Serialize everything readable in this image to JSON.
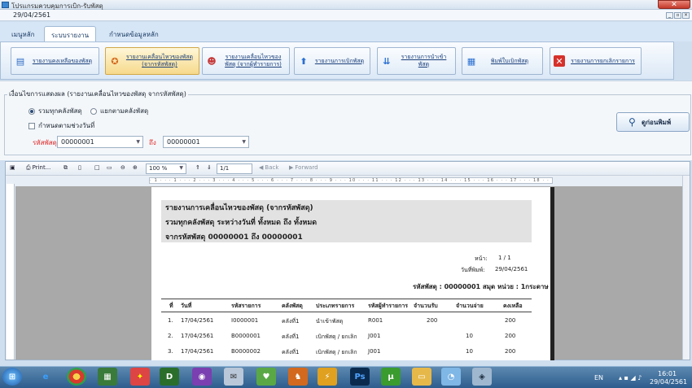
{
  "window": {
    "title": "โปรแกรมควบคุมการเบิก-รับพัสดุ",
    "date": "29/04/2561"
  },
  "tabs": [
    "เมนูหลัก",
    "ระบบรายงาน",
    "กำหนดข้อมูลหลัก"
  ],
  "ribbon": [
    {
      "label": "รายงานคงเหลือของพัสดุ",
      "icon": "stock-report-icon"
    },
    {
      "label": "รายงานเคลื่อนไหวของพัสดุ (จากรหัสพัสดุ)",
      "icon": "movement-by-item-icon"
    },
    {
      "label": "รายงานเคลื่อนไหวของพัสดุ (จากผู้ทำรายการ)",
      "icon": "movement-by-user-icon"
    },
    {
      "label": "รายงานการเบิกพัสดุ",
      "icon": "withdraw-report-icon"
    },
    {
      "label": "รายงานการนำเข้าพัสดุ",
      "icon": "import-report-icon"
    },
    {
      "label": "พิมพ์ใบเบิกพัสดุ",
      "icon": "print-form-icon"
    },
    {
      "label": "รายงานการยกเลิกรายการ",
      "icon": "cancel-report-icon"
    }
  ],
  "options": {
    "group_title": "เงื่อนไขการแสดงผล (รายงานเคลื่อนไหวของพัสดุ จากรหัสพัสดุ)",
    "radio_all": "รวมทุกคลังพัสดุ",
    "radio_split": "แยกตามคลังพัสดุ",
    "date_check": "กำหนดตามช่วงวันที่",
    "code_label": "รหัสพัสดุ",
    "code_from": "00000001",
    "to_label": "ถึง",
    "code_to": "00000001",
    "preview_button": "ดูก่อนพิมพ์"
  },
  "viewer": {
    "print_label": "Print...",
    "zoom": "100 %",
    "page_box": "1/1",
    "back": "Back",
    "forward": "Forward"
  },
  "report": {
    "title": "รายงานการเคลื่อนไหวของพัสดุ (จากรหัสพัสดุ)",
    "line2": "รวมทุกคลังพัสดุ ระหว่างวันที่   ทั้งหมด  ถึง  ทั้งหมด",
    "line3": "จากรหัสพัสดุ 00000001  ถึง  00000001",
    "page_label": "หน้า:",
    "page_value": "1  /  1",
    "print_date_label": "วันที่พิมพ์:",
    "print_date": "29/04/2561",
    "item_line": "รหัสพัสดุ : 00000001 สมุด หน่วย : 1กระดาษ",
    "columns": [
      "ที่",
      "วันที่",
      "รหัสรายการ",
      "คลังพัสดุ",
      "ประเภทรายการ",
      "รหัสผู้ทำรายการ",
      "จำนวนรับ",
      "จำนวนจ่าย",
      "คงเหลือ"
    ],
    "rows": [
      [
        "1.",
        "17/04/2561",
        "I0000001",
        "คลังที่1",
        "นำเข้าพัสดุ",
        "R001",
        "200",
        "",
        "200"
      ],
      [
        "2.",
        "17/04/2561",
        "B0000001",
        "คลังที่1",
        "เบิกพัสดุ / ยกเลิก",
        "J001",
        "",
        "10",
        "200"
      ],
      [
        "3.",
        "17/04/2561",
        "B0000002",
        "คลังที่1",
        "เบิกพัสดุ / ยกเลิก",
        "J001",
        "",
        "10",
        "200"
      ]
    ]
  },
  "taskbar": {
    "lang": "EN",
    "time": "16:01",
    "date": "29/04/2561"
  }
}
